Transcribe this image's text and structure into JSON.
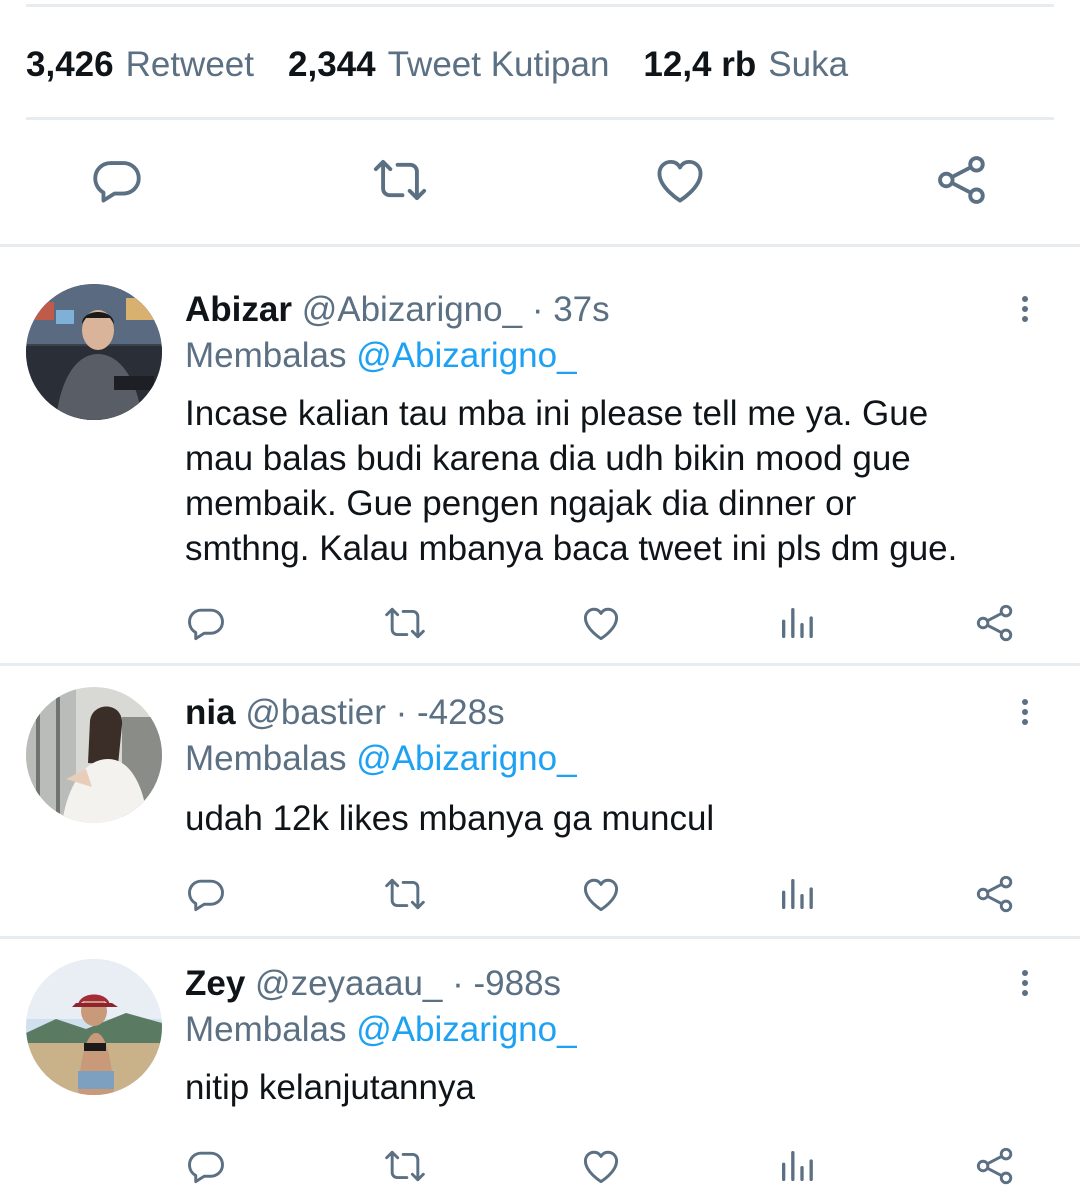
{
  "stats": {
    "retweets": {
      "count": "3,426",
      "label": "Retweet"
    },
    "quotes": {
      "count": "2,344",
      "label": "Tweet Kutipan"
    },
    "likes": {
      "count": "12,4 rb",
      "label": "Suka"
    }
  },
  "main_actions": [
    "reply-icon",
    "retweet-icon",
    "like-icon",
    "share-icon"
  ],
  "row_actions": [
    "reply-icon",
    "retweet-icon",
    "like-icon",
    "analytics-icon",
    "share-icon"
  ],
  "colors": {
    "icon": "#5b7083",
    "mention": "#1da1f2",
    "divider": "#e6ecf0"
  },
  "replies": [
    {
      "name": "Abizar",
      "handle": "@Abizarigno_",
      "time": "37s",
      "replying_label": "Membalas",
      "replying_to": "@Abizarigno_",
      "text_lines": [
        "Incase kalian tau mba ini please tell me ya. Gue",
        "mau balas budi karena dia udh bikin mood gue",
        "membaik. Gue pengen ngajak dia dinner or",
        "smthng. Kalau mbanya baca tweet ini pls dm gue."
      ]
    },
    {
      "name": "nia",
      "handle": "@bastier",
      "time": "-428s",
      "replying_label": "Membalas",
      "replying_to": "@Abizarigno_",
      "text_lines": [
        "udah 12k likes mbanya ga muncul"
      ]
    },
    {
      "name": "Zey",
      "handle": "@zeyaaau_",
      "time": "-988s",
      "replying_label": "Membalas",
      "replying_to": "@Abizarigno_",
      "text_lines": [
        "nitip kelanjutannya"
      ]
    }
  ]
}
